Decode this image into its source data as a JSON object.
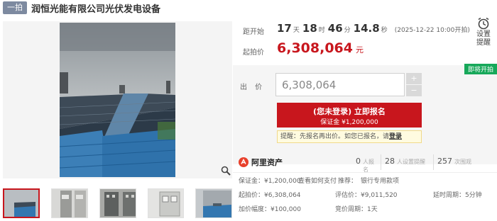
{
  "header": {
    "badge": "一拍",
    "title": "润恒光能有限公司光伏发电设备"
  },
  "auction": {
    "countdown_label": "距开始",
    "countdown": {
      "days": "17",
      "days_unit": "天",
      "hours": "18",
      "hours_unit": "时",
      "minutes": "46",
      "minutes_unit": "分",
      "seconds": "14.8",
      "seconds_unit": "秒"
    },
    "start_time": "(2025-12-22 10:00开拍)",
    "reminder_label_1": "设置",
    "reminder_label_2": "提醒",
    "start_price_label": "起拍价",
    "start_price": "6,308,064",
    "currency_unit": "元",
    "live_tag": "即将开拍",
    "bid_label": "出 价",
    "bid_value": "6,308,064",
    "stepper_plus": "+",
    "stepper_minus": "−",
    "register_button": "(您未登录) 立即报名",
    "deposit_line": "保证金 ¥1,200,000",
    "notice_text": "提醒：先报名再出价。如您已报名，请",
    "notice_link": "登录"
  },
  "stats": {
    "brand": "阿里资产",
    "signups": "0",
    "signups_label": "人报名",
    "reminders": "28",
    "reminders_label": "人设置提醒",
    "views": "257",
    "views_label": "次围观"
  },
  "details": {
    "deposit": "保证金：¥1,200,000",
    "how_to_pay": "查看如何支付",
    "recommend_label": "推荐：",
    "recommend_link": "银行专用款项",
    "start_price": "起拍价：¥6,308,064",
    "appraisal": "评估价：¥9,011,520",
    "delay": "延时周期：5分钟",
    "increment": "加价幅度：¥100,000",
    "cycle": "竞价周期：1天"
  },
  "colors": {
    "accent_red": "#c8161d",
    "live_green": "#17a85a",
    "link_blue": "#2a6fc9"
  }
}
